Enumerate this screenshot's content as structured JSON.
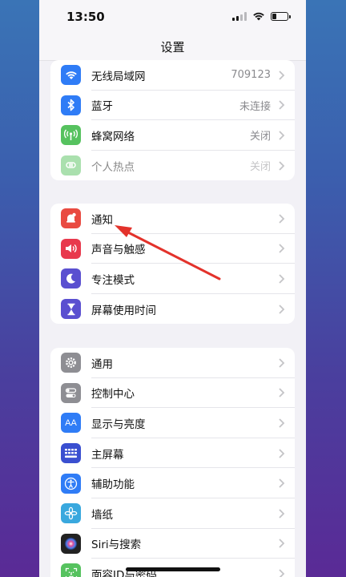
{
  "status_bar": {
    "time": "13:50"
  },
  "header": {
    "title": "设置"
  },
  "groups": [
    {
      "items": [
        {
          "label": "无线局域网",
          "value": "709123",
          "icon": "wifi-icon",
          "color": "#2f7cf6"
        },
        {
          "label": "蓝牙",
          "value": "未连接",
          "icon": "bluetooth-icon",
          "color": "#2f7cf6"
        },
        {
          "label": "蜂窝网络",
          "value": "关闭",
          "icon": "cellular-icon",
          "color": "#56c25f"
        },
        {
          "label": "个人热点",
          "value": "关闭",
          "icon": "hotspot-icon",
          "color": "#56c25f"
        }
      ]
    },
    {
      "items": [
        {
          "label": "通知",
          "icon": "notification-icon",
          "color": "#e94a41"
        },
        {
          "label": "声音与触感",
          "icon": "speaker-icon",
          "color": "#e8394d"
        },
        {
          "label": "专注模式",
          "icon": "moon-icon",
          "color": "#5a4fd0"
        },
        {
          "label": "屏幕使用时间",
          "icon": "hourglass-icon",
          "color": "#5a4fd0"
        }
      ]
    },
    {
      "items": [
        {
          "label": "通用",
          "icon": "gear-icon",
          "color": "#8e8e93"
        },
        {
          "label": "控制中心",
          "icon": "toggle-icon",
          "color": "#8e8e93"
        },
        {
          "label": "显示与亮度",
          "icon": "aa-icon",
          "color": "#2f7cf6"
        },
        {
          "label": "主屏幕",
          "icon": "grid-icon",
          "color": "#3a4fd0"
        },
        {
          "label": "辅助功能",
          "icon": "accessibility-icon",
          "color": "#2f7cf6"
        },
        {
          "label": "墙纸",
          "icon": "flower-icon",
          "color": "#39a8de"
        },
        {
          "label": "Siri与搜索",
          "icon": "siri-icon",
          "color": "#222222"
        },
        {
          "label": "面容ID与密码",
          "icon": "faceid-icon",
          "color": "#56c25f"
        }
      ]
    }
  ],
  "annotation": {
    "color": "#e3322b"
  }
}
